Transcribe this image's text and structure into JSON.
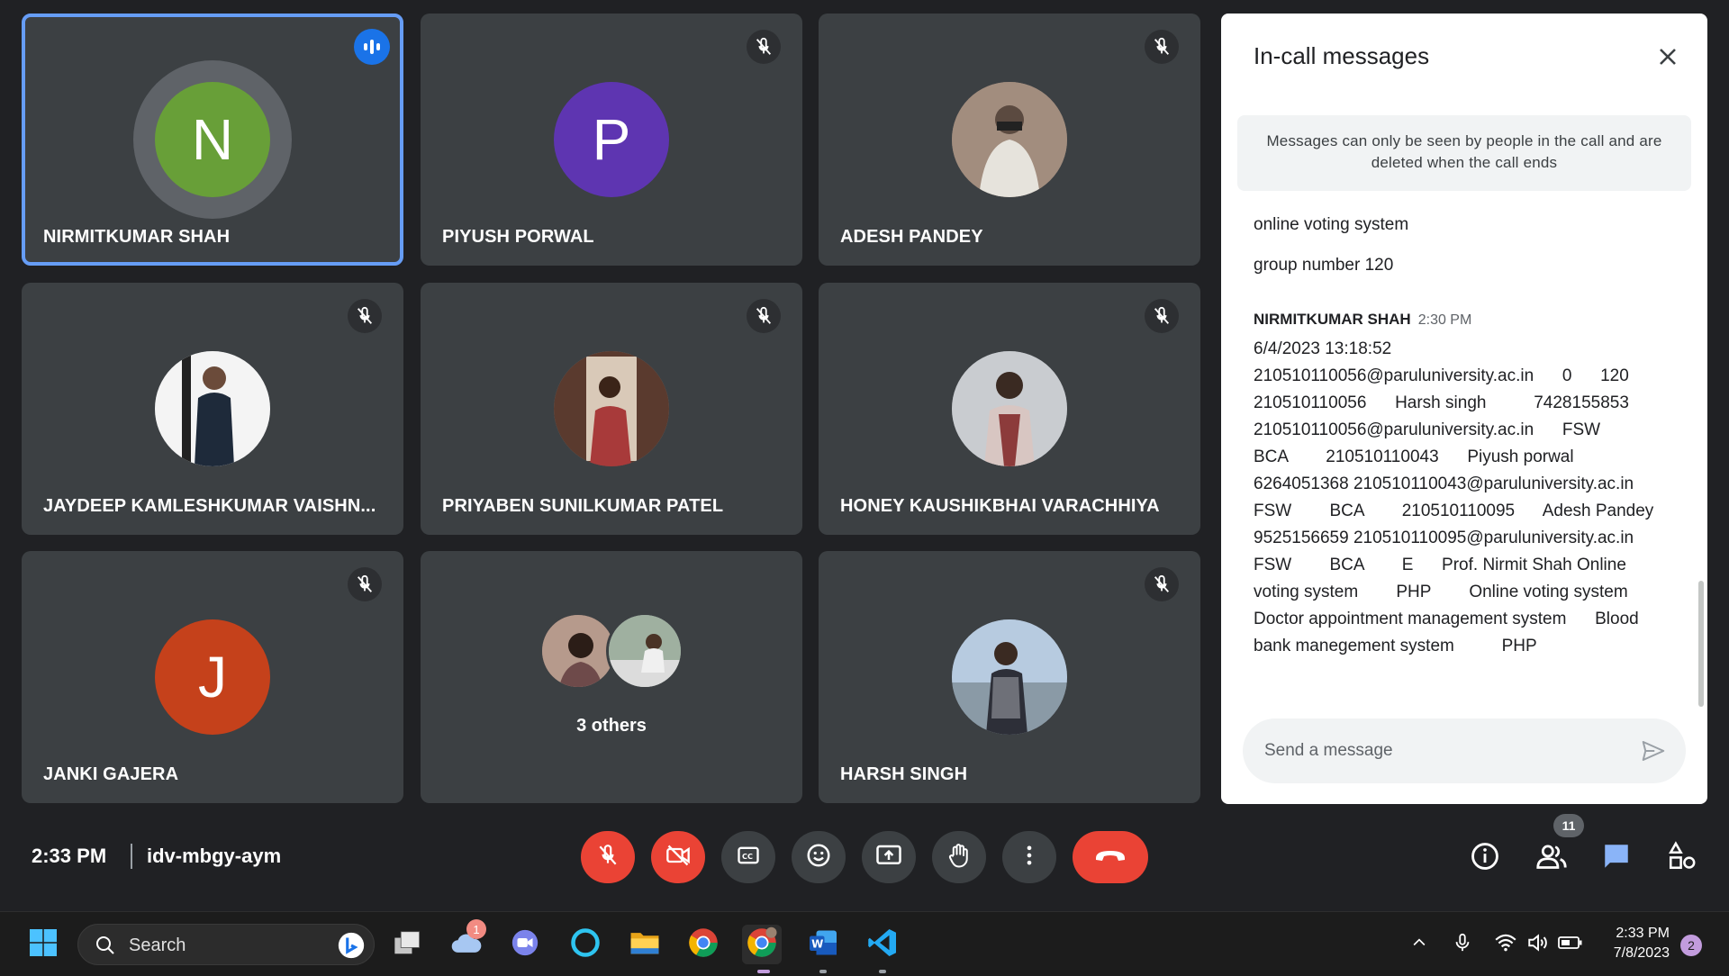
{
  "tiles": [
    {
      "name": "NIRMITKUMAR SHAH",
      "initial": "N",
      "color": "#689f38"
    },
    {
      "name": "PIYUSH PORWAL",
      "initial": "P",
      "color": "#5e35b1"
    },
    {
      "name": "ADESH PANDEY"
    },
    {
      "name": "JAYDEEP KAMLESHKUMAR VAISHN..."
    },
    {
      "name": "PRIYABEN SUNILKUMAR PATEL"
    },
    {
      "name": "HONEY KAUSHIKBHAI VARACHHIYA"
    },
    {
      "name": "JANKI GAJERA",
      "initial": "J",
      "color": "#c5411b"
    },
    {
      "others": "3 others"
    },
    {
      "name": "HARSH SINGH"
    }
  ],
  "chat": {
    "title": "In-call messages",
    "notice": "Messages can only be seen by people in the call and are deleted when the call ends",
    "messages": [
      "online voting system",
      "group number 120"
    ],
    "sender": "NIRMITKUMAR SHAH",
    "sender_time": "2:30 PM",
    "long_message": "6/4/2023 13:18:52\n210510110056@paruluniversity.ac.in      0      120\n210510110056      Harsh singh          7428155853\n210510110056@paruluniversity.ac.in      FSW\nBCA        210510110043      Piyush porwal\n6264051368 210510110043@paruluniversity.ac.in\nFSW        BCA        210510110095      Adesh Pandey\n9525156659 210510110095@paruluniversity.ac.in\nFSW        BCA        E      Prof. Nirmit Shah Online\nvoting system        PHP        Online voting system\nDoctor appointment management system      Blood\nbank manegement system          PHP",
    "input_placeholder": "Send a message"
  },
  "callbar": {
    "time": "2:33 PM",
    "meeting_code": "idv-mbgy-aym",
    "participants_count": "11"
  },
  "taskbar": {
    "search_label": "Search",
    "weather_badge": "1",
    "clock_time": "2:33 PM",
    "clock_date": "7/8/2023",
    "notification_count": "2"
  },
  "icons": [
    "mic-off-icon",
    "camera-off-icon",
    "captions-icon",
    "emoji-icon",
    "present-icon",
    "raise-hand-icon",
    "more-options-icon",
    "end-call-icon",
    "info-icon",
    "people-icon",
    "chat-icon",
    "activities-icon"
  ],
  "colors": {
    "accent": "#1a73e8",
    "active_border": "#669df6",
    "danger": "#ea4335",
    "tile_bg": "#3c4043",
    "bg": "#202124"
  }
}
